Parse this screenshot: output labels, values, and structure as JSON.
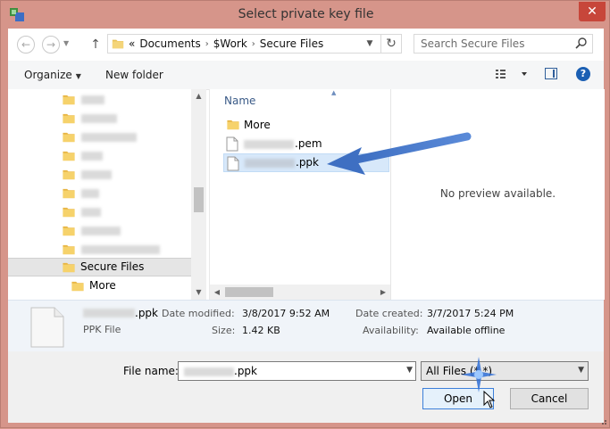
{
  "window": {
    "title": "Select private key file"
  },
  "address": {
    "overflow": "«",
    "crumbs": [
      "Documents",
      "$Work",
      "Secure Files"
    ]
  },
  "search": {
    "placeholder": "Search Secure Files"
  },
  "toolbar": {
    "organize": "Organize",
    "new_folder": "New folder"
  },
  "nav": {
    "selected": "Secure Files",
    "child": "More"
  },
  "files": {
    "column": "Name",
    "items": [
      {
        "name": "More",
        "kind": "folder"
      },
      {
        "name": ".pem",
        "kind": "file"
      },
      {
        "name": ".ppk",
        "kind": "file",
        "selected": true
      }
    ]
  },
  "preview": {
    "text": "No preview available."
  },
  "details": {
    "name": ".ppk",
    "type": "PPK File",
    "date_modified_label": "Date modified:",
    "date_modified": "3/8/2017 9:52 AM",
    "size_label": "Size:",
    "size": "1.42 KB",
    "date_created_label": "Date created:",
    "date_created": "3/7/2017 5:24 PM",
    "availability_label": "Availability:",
    "availability": "Available offline"
  },
  "bottom": {
    "file_name_label": "File name:",
    "file_name": ".ppk",
    "file_type": "All Files (*.*)",
    "open": "Open",
    "cancel": "Cancel"
  },
  "colors": {
    "frame": "#d6958a",
    "close": "#c7463a",
    "selection": "#d7e8fa",
    "annotation_arrow": "#4a79c9"
  }
}
